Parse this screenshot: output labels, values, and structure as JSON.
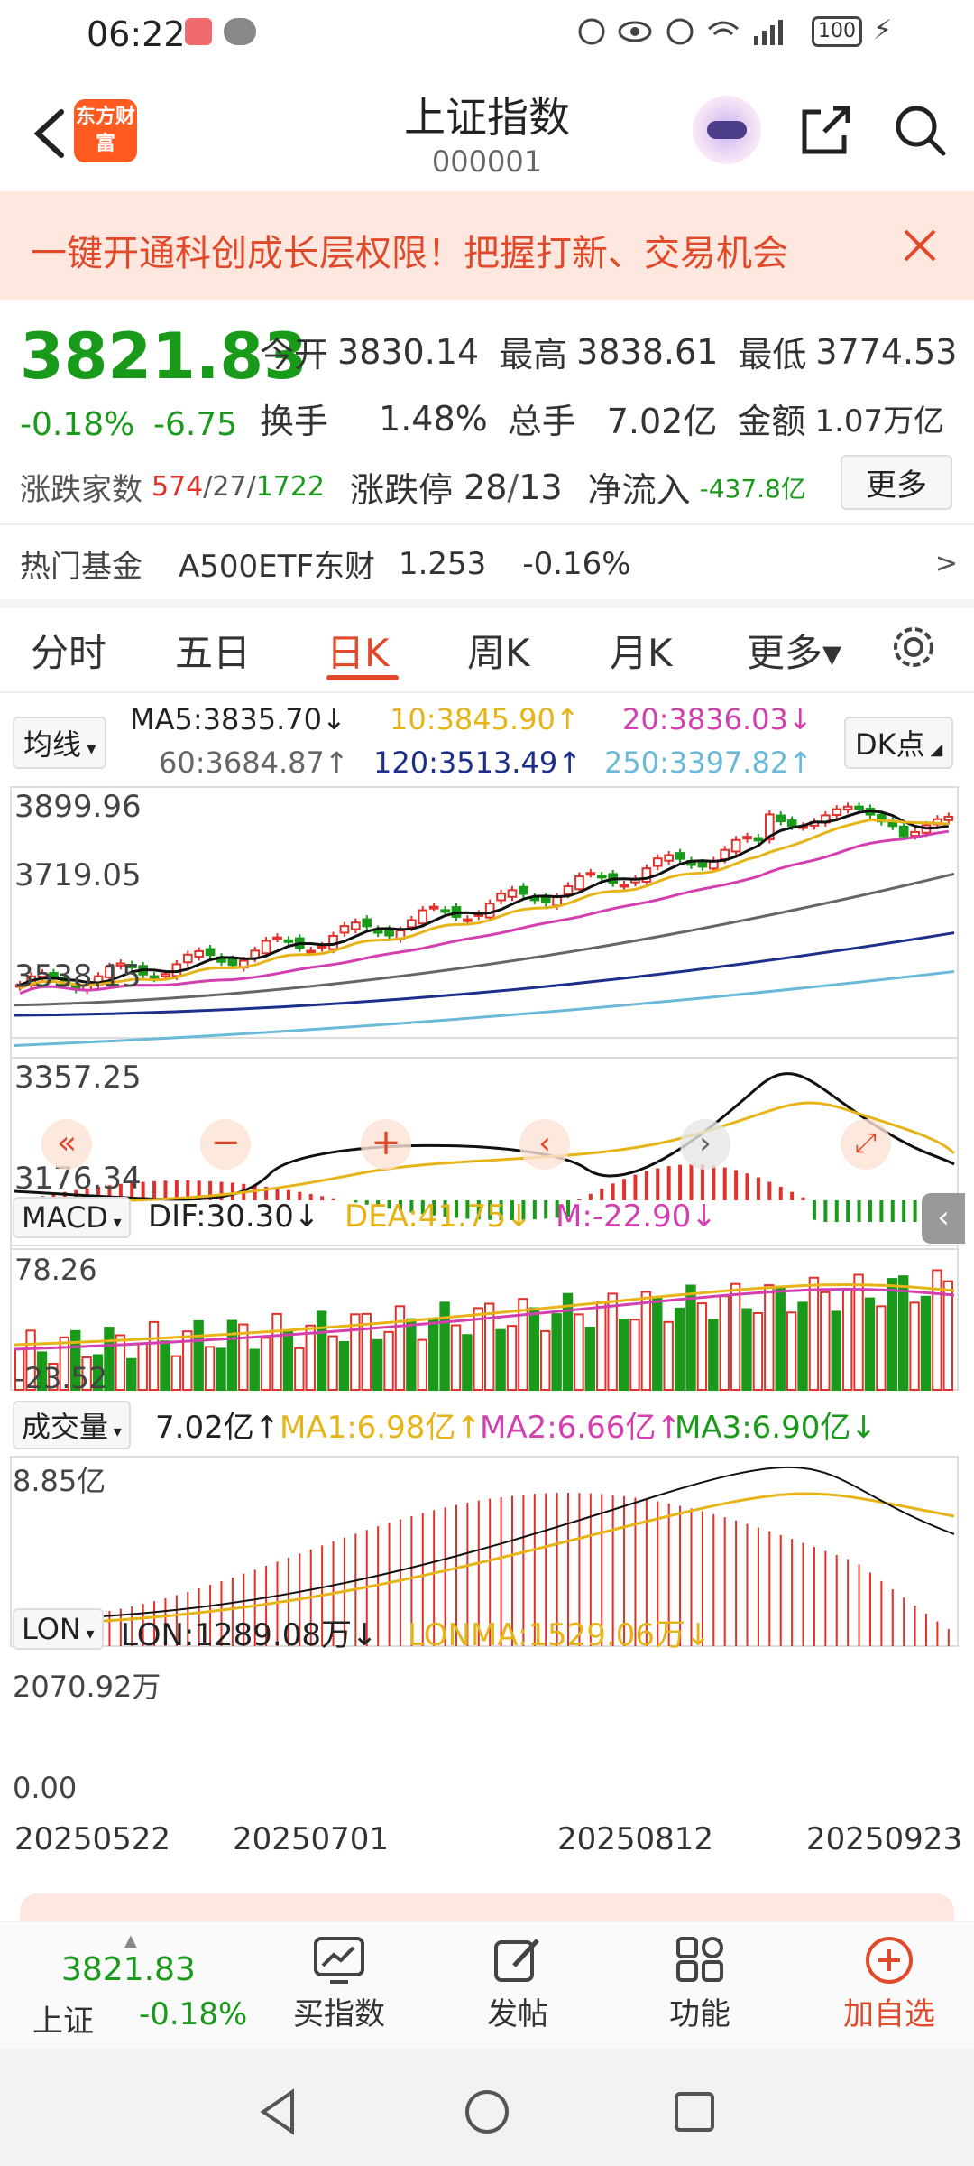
{
  "status": {
    "time": "06:22",
    "battery": "100"
  },
  "header": {
    "title": "上证指数",
    "code": "000001",
    "logo_text": "东方财富"
  },
  "banner": {
    "text": "一键开通科创成长层权限！把握打新、交易机会"
  },
  "quote": {
    "price": "3821.83",
    "change_pct": "-0.18%",
    "change": "-6.75",
    "open_label": "今开",
    "open": "3830.14",
    "high_label": "最高",
    "high": "3838.61",
    "low_label": "最低",
    "low": "3774.53",
    "turnover_label": "换手",
    "turnover": "1.48%",
    "volume_label": "总手",
    "volume": "7.02亿",
    "amount_label": "金额",
    "amount": "1.07万亿",
    "breadth_label": "涨跌家数",
    "breadth_up": "574",
    "breadth_flat": "27",
    "breadth_down": "1722",
    "limit_label": "涨跌停",
    "limit_up": "28",
    "limit_down": "13",
    "netflow_label": "净流入",
    "netflow": "-437.8亿",
    "more_button": "更多"
  },
  "hot_fund": {
    "label": "热门基金",
    "name": "A500ETF东财",
    "price": "1.253",
    "change": "-0.16%",
    "arrow": ">"
  },
  "tabs": [
    "分时",
    "五日",
    "日K",
    "周K",
    "月K",
    "更多▾"
  ],
  "ma_panel": {
    "selector": "均线",
    "ma5": "MA5:3835.70↓",
    "ma10": "10:3845.90↑",
    "ma20": "20:3836.03↓",
    "ma60": "60:3684.87↑",
    "ma120": "120:3513.49↑",
    "ma250": "250:3397.82↑",
    "dk": "DK点"
  },
  "kline_axis": [
    "3899.96",
    "3719.05",
    "3538.15",
    "3357.25",
    "3176.34"
  ],
  "macd": {
    "selector": "MACD",
    "dif": "DIF:30.30↓",
    "dea": "DEA:41.75↓",
    "m": "M:-22.90↓",
    "top": "78.26",
    "bottom": "-23.52"
  },
  "vol": {
    "selector": "成交量",
    "value": "7.02亿↑",
    "ma1": "MA1:6.98亿↑",
    "ma2": "MA2:6.66亿↑",
    "ma3": "MA3:6.90亿↓",
    "top": "8.85亿"
  },
  "lon": {
    "selector": "LON",
    "lon": "LON:1289.08万↓",
    "lonma": "LONMA:1529.06万↓",
    "top": "2070.92万",
    "bottom": "0.00"
  },
  "dates": [
    "20250522",
    "20250701",
    "20250812",
    "20250923"
  ],
  "colors": {
    "up": "#e0312a",
    "down": "#1a9a1a",
    "accent": "#e04a2a",
    "ma5": "#111111",
    "ma10": "#e7b418",
    "ma20": "#d43fb0",
    "ma60": "#666666",
    "ma120": "#1d2f8a",
    "ma250": "#6bb9d9"
  },
  "bottom": {
    "index_price": "3821.83",
    "index_name": "上证",
    "index_change": "-0.18%",
    "buy_label": "买指数",
    "post_label": "发帖",
    "func_label": "功能",
    "add_label": "加自选"
  }
}
